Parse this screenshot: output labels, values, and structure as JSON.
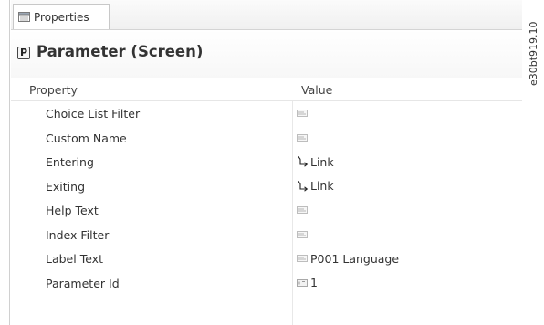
{
  "tab": {
    "label": "Properties",
    "icon": "properties-window-icon"
  },
  "header": {
    "title": "Parameter (Screen)",
    "icon": "parameter-p-icon",
    "icon_letter": "P"
  },
  "table": {
    "columns": [
      "Property",
      "Value"
    ],
    "rows": [
      {
        "property": "Choice List Filter",
        "value": "",
        "value_icon": "text-value-icon"
      },
      {
        "property": "Custom Name",
        "value": "",
        "value_icon": "text-value-icon"
      },
      {
        "property": "Entering",
        "value": "Link",
        "value_icon": "link-arrow-icon"
      },
      {
        "property": "Exiting",
        "value": "Link",
        "value_icon": "link-arrow-icon"
      },
      {
        "property": "Help Text",
        "value": "",
        "value_icon": "text-value-icon"
      },
      {
        "property": "Index Filter",
        "value": "",
        "value_icon": "text-value-icon"
      },
      {
        "property": "Label Text",
        "value": "P001 Language",
        "value_icon": "text-value-icon"
      },
      {
        "property": "Parameter Id",
        "value": "1",
        "value_icon": "number-value-icon"
      }
    ]
  },
  "watermark": "e30bt919.10"
}
